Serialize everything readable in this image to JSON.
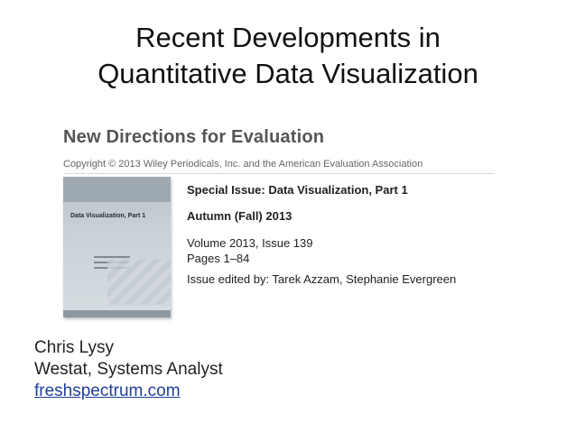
{
  "slide": {
    "title_line1": "Recent Developments in",
    "title_line2": "Quantitative Data Visualization"
  },
  "journal": {
    "name": "New Directions for Evaluation",
    "copyright": "Copyright © 2013 Wiley Periodicals, Inc. and the American Evaluation Association",
    "cover_label": "Data Visualization, Part 1",
    "special_issue": "Special Issue: Data Visualization, Part 1",
    "season": "Autumn (Fall) 2013",
    "volume": "Volume 2013, Issue 139",
    "pages": "Pages 1–84",
    "editors": "Issue edited by: Tarek Azzam, Stephanie Evergreen"
  },
  "author": {
    "name": "Chris Lysy",
    "affiliation": "Westat, Systems Analyst",
    "website": "freshspectrum.com"
  }
}
